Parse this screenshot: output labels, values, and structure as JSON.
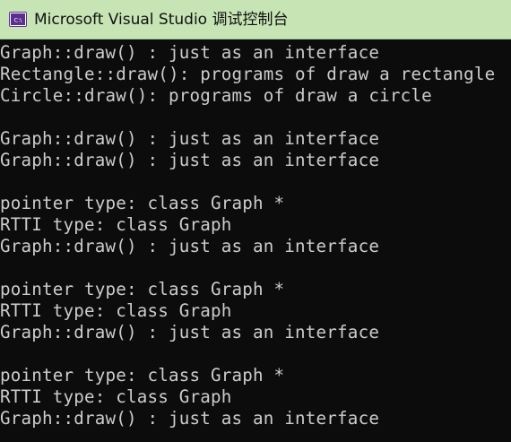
{
  "window": {
    "title": "Microsoft Visual Studio 调试控制台",
    "icon": "visual-studio-debug-console-icon",
    "icon_text": "C:\\"
  },
  "colors": {
    "titlebar_bg": "#c6e4b4",
    "console_bg": "#0c0c0c",
    "console_text": "#cccccc",
    "icon_bg": "#5c2d91"
  },
  "console": {
    "lines": [
      "Graph::draw() : just as an interface",
      "Rectangle::draw(): programs of draw a rectangle",
      "Circle::draw(): programs of draw a circle",
      "",
      "Graph::draw() : just as an interface",
      "Graph::draw() : just as an interface",
      "",
      "pointer type: class Graph *",
      "RTTI type: class Graph",
      "Graph::draw() : just as an interface",
      "",
      "pointer type: class Graph *",
      "RTTI type: class Graph",
      "Graph::draw() : just as an interface",
      "",
      "pointer type: class Graph *",
      "RTTI type: class Graph",
      "Graph::draw() : just as an interface",
      ""
    ]
  }
}
